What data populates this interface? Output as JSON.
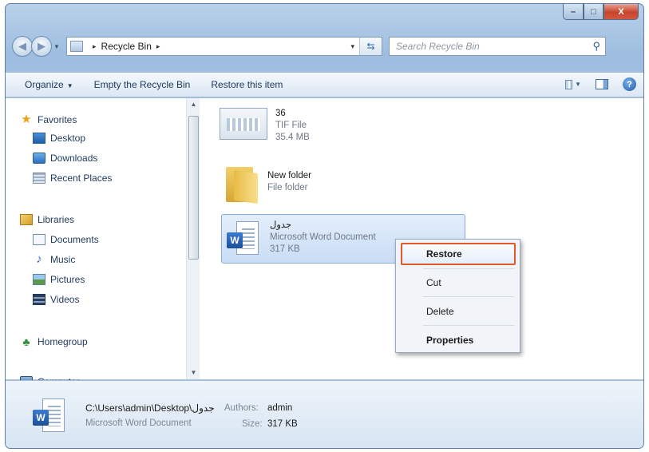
{
  "window": {
    "caption": {
      "minimize": "–",
      "maximize": "□",
      "close": "X"
    }
  },
  "address": {
    "location": "Recycle Bin",
    "separator": "▸",
    "dropdown": "▾"
  },
  "search": {
    "placeholder": "Search Recycle Bin",
    "icon": "magnifier-icon"
  },
  "toolbar": {
    "organize": "Organize",
    "empty": "Empty the Recycle Bin",
    "restore": "Restore this item",
    "help": "?"
  },
  "nav": {
    "favorites": "Favorites",
    "desktop": "Desktop",
    "downloads": "Downloads",
    "recent": "Recent Places",
    "libraries": "Libraries",
    "documents": "Documents",
    "music": "Music",
    "pictures": "Pictures",
    "videos": "Videos",
    "homegroup": "Homegroup",
    "computer": "Computer"
  },
  "files": [
    {
      "name": "36",
      "type": "TIF File",
      "size": "35.4 MB"
    },
    {
      "name": "New folder",
      "type": "File folder",
      "size": ""
    },
    {
      "name": "جدول",
      "type": "Microsoft Word Document",
      "size": "317 KB"
    }
  ],
  "context_menu": {
    "restore": "Restore",
    "cut": "Cut",
    "delete": "Delete",
    "properties": "Properties"
  },
  "details": {
    "path": "C:\\Users\\admin\\Desktop\\جدول",
    "type": "Microsoft Word Document",
    "authors_label": "Authors:",
    "authors_value": "admin",
    "size_label": "Size:",
    "size_value": "317 KB"
  },
  "colors": {
    "highlight_border": "#e05a2b",
    "selection": "#c9ddf5",
    "frame": "#a9c6e4"
  }
}
